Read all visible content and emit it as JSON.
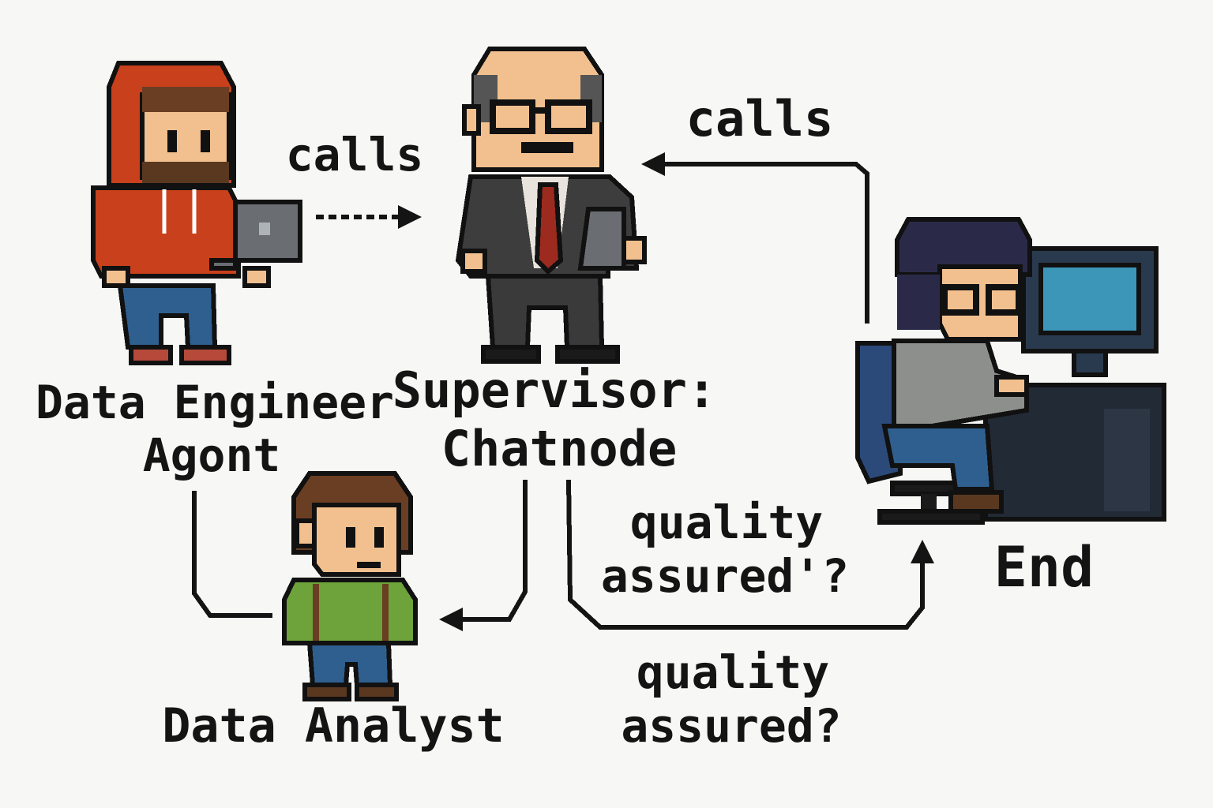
{
  "nodes": {
    "data_engineer": {
      "line1": "Data Engineer",
      "line2": "Agont"
    },
    "supervisor": {
      "line1": "Supervisor:",
      "line2": "Chatnode"
    },
    "data_analyst": {
      "label": "Data Analyst"
    },
    "end": {
      "label": "End"
    }
  },
  "edges": {
    "engineer_to_supervisor": {
      "label": "calls"
    },
    "end_to_supervisor": {
      "label": "calls"
    },
    "supervisor_to_end": {
      "line1": "quality",
      "line2": "assured'?"
    },
    "below_note": {
      "line1": "quality",
      "line2": "assured?"
    }
  },
  "colors": {
    "line": "#141414",
    "hoodie": "#c8401c",
    "jeans": "#2f5f8f",
    "suit": "#3d3d3d",
    "tie": "#9c2a1e",
    "shirt_green": "#6da33a",
    "skin": "#f2c08e",
    "monitor_screen": "#3b96b8",
    "desk": "#222a36"
  },
  "icons": [
    "hooded-engineer-icon",
    "bald-supervisor-icon",
    "analyst-icon",
    "computer-user-icon"
  ]
}
